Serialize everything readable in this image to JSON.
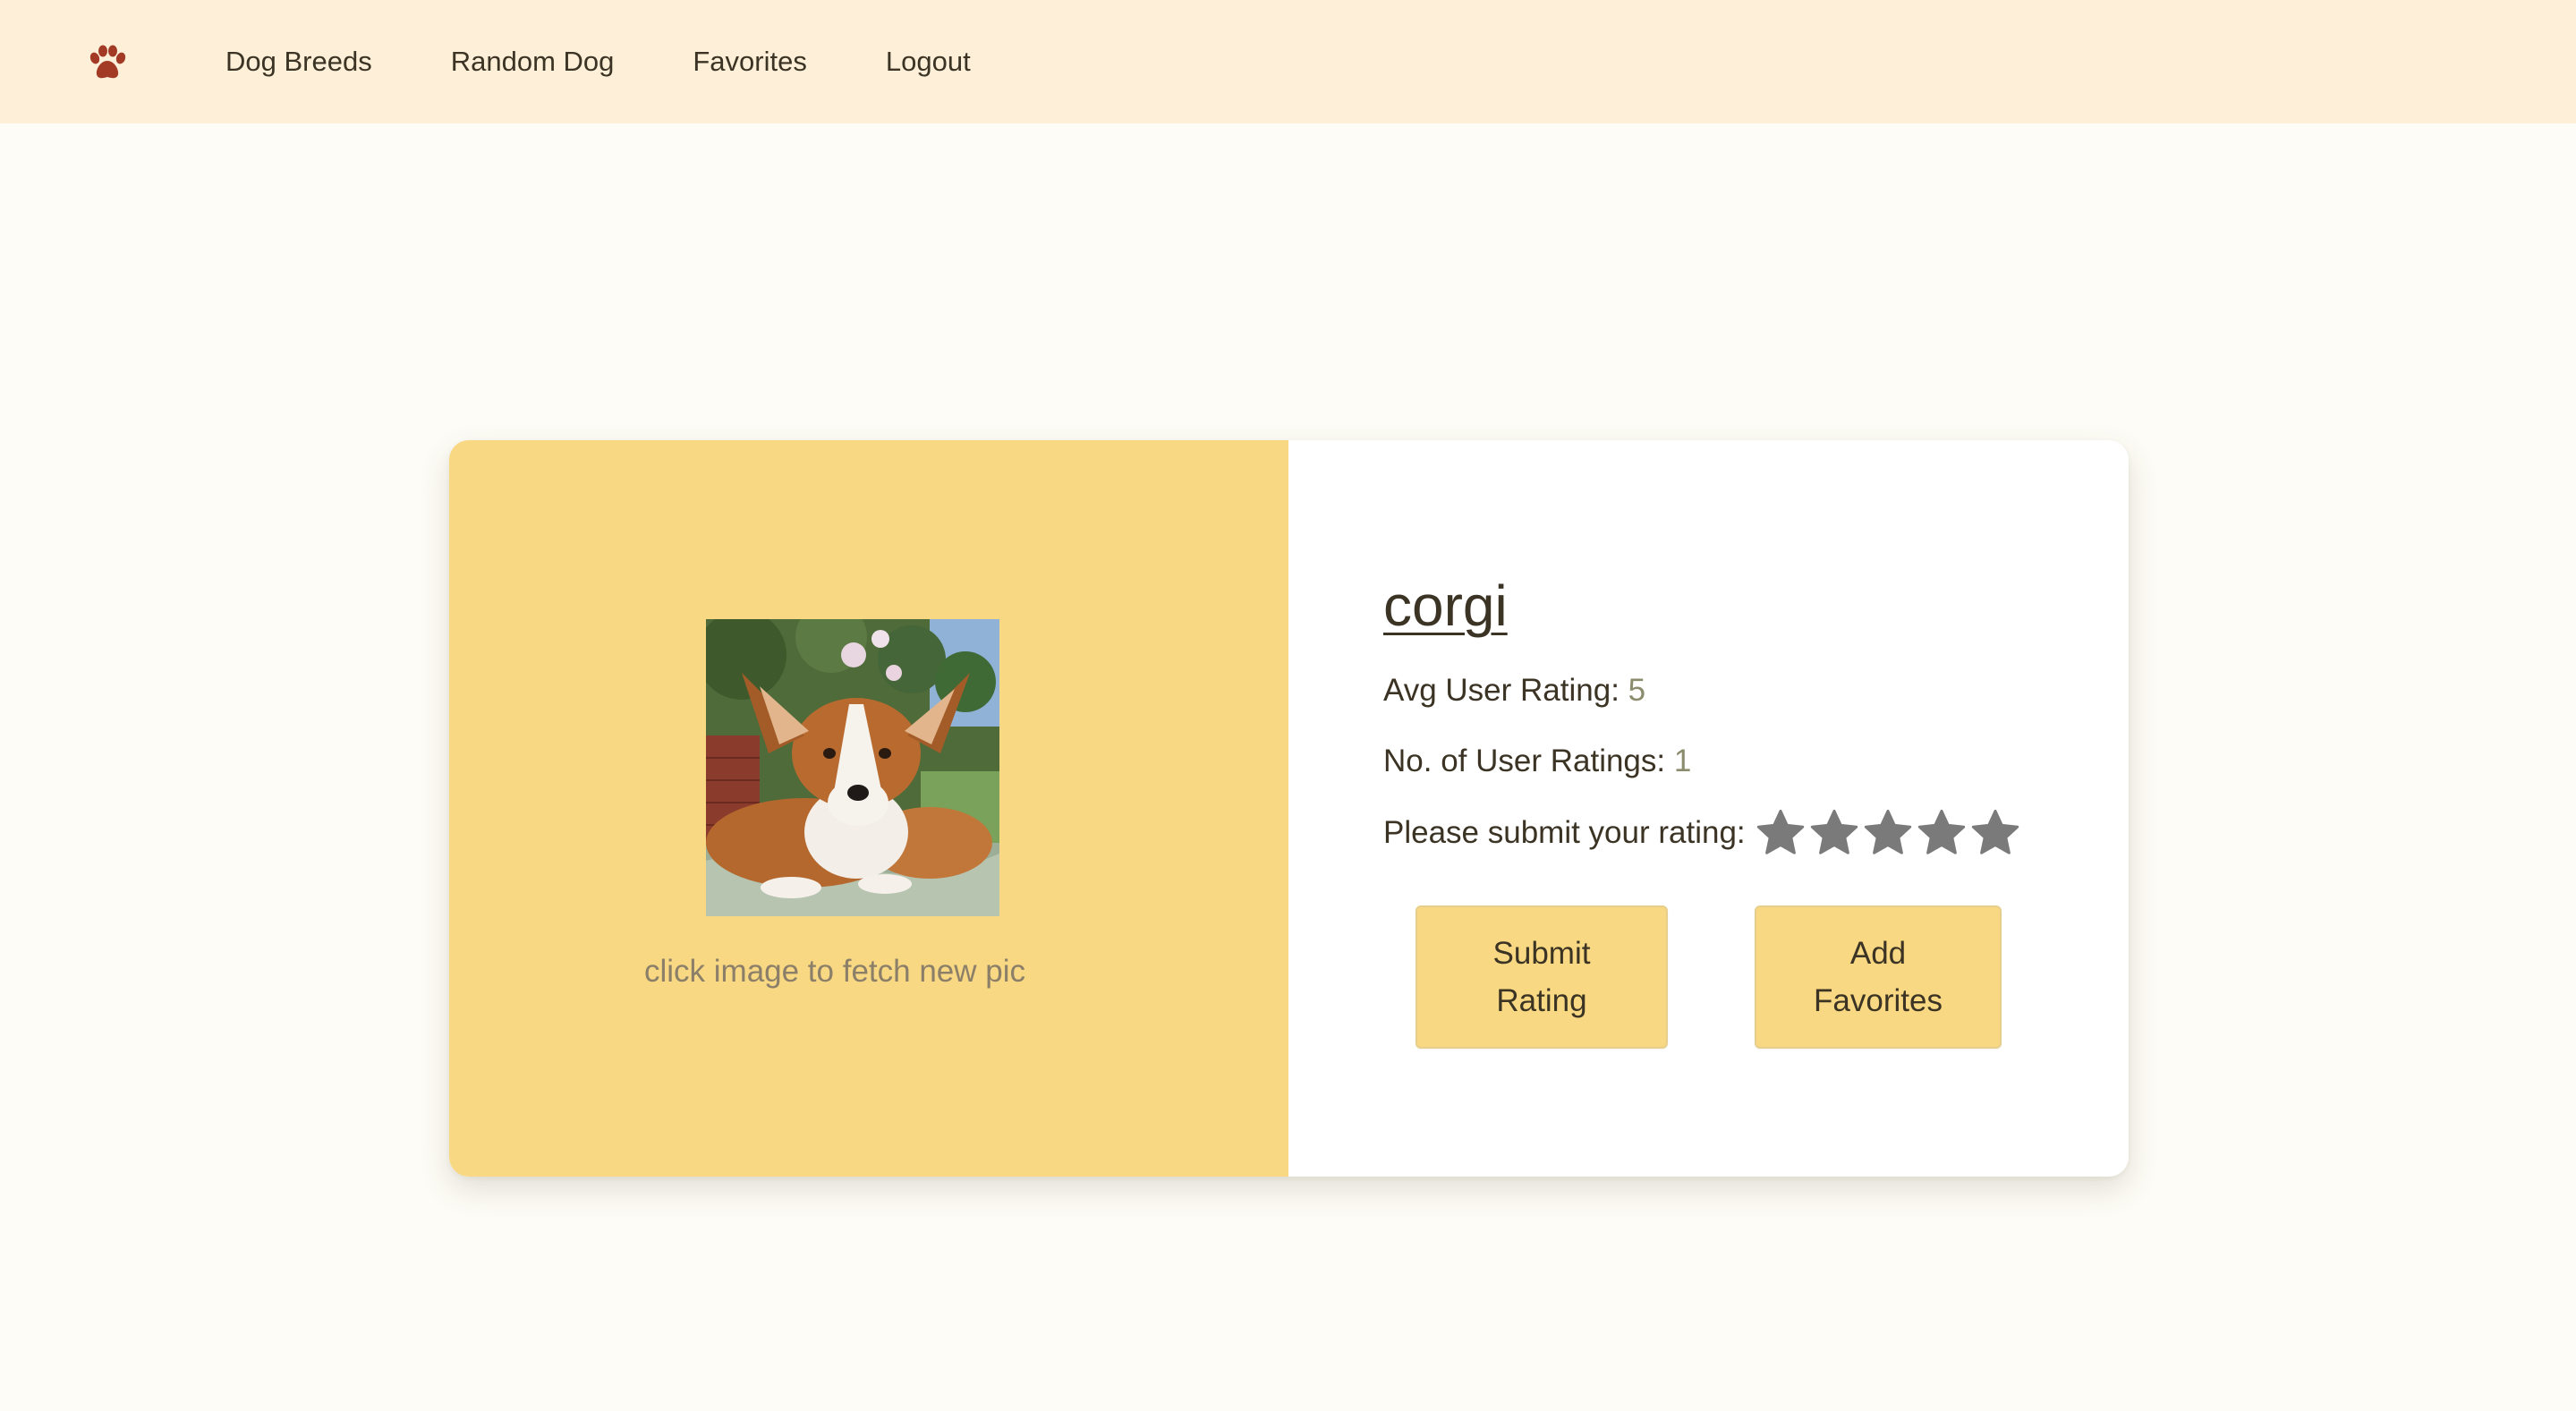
{
  "nav": {
    "logo_icon": "paw-icon",
    "logo_color": "#a33a25",
    "links": [
      {
        "label": "Dog Breeds"
      },
      {
        "label": "Random Dog"
      },
      {
        "label": "Favorites"
      },
      {
        "label": "Logout"
      }
    ]
  },
  "card": {
    "photo_alt": "corgi photo",
    "photo_hint": "click image to fetch new pic",
    "breed_name": "corgi",
    "avg_rating_label": "Avg User Rating: ",
    "avg_rating_value": "5",
    "num_ratings_label": "No. of User Ratings: ",
    "num_ratings_value": "1",
    "submit_prompt": "Please submit your rating:",
    "stars": {
      "count": 5,
      "selected": 0,
      "icon": "star-icon",
      "color": "#7a7a7a"
    },
    "submit_button": "Submit Rating",
    "favorites_button": "Add Favorites"
  },
  "colors": {
    "nav_bg": "#fdefd8",
    "page_bg": "#fdfcf6",
    "accent": "#f8d882",
    "text": "#3b3324",
    "muted": "#8b8b6e"
  }
}
